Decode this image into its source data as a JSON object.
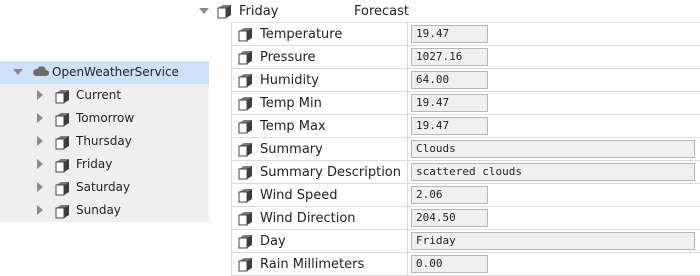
{
  "nav": {
    "root": {
      "label": "OpenWeatherService",
      "icon": "cloud-icon"
    },
    "items": [
      {
        "label": "Current"
      },
      {
        "label": "Tomorrow"
      },
      {
        "label": "Thursday"
      },
      {
        "label": "Friday"
      },
      {
        "label": "Saturday"
      },
      {
        "label": "Sunday"
      }
    ]
  },
  "sheet": {
    "title": "Friday",
    "description": "Forecast",
    "properties": [
      {
        "name": "Temperature",
        "value": "19.47"
      },
      {
        "name": "Pressure",
        "value": "1027.16"
      },
      {
        "name": "Humidity",
        "value": "64.00"
      },
      {
        "name": "Temp Min",
        "value": "19.47"
      },
      {
        "name": "Temp Max",
        "value": "19.47"
      },
      {
        "name": "Summary",
        "value": "Clouds"
      },
      {
        "name": "Summary Description",
        "value": "scattered clouds"
      },
      {
        "name": "Wind Speed",
        "value": "2.06"
      },
      {
        "name": "Wind Direction",
        "value": "204.50"
      },
      {
        "name": "Day",
        "value": "Friday"
      },
      {
        "name": "Rain Millimeters",
        "value": "0.00"
      }
    ]
  },
  "colors": {
    "selection": "#cde1f9",
    "navBackground": "#efefef",
    "grid": "#dcdcdc",
    "fieldBackground": "#f0f0f0"
  }
}
